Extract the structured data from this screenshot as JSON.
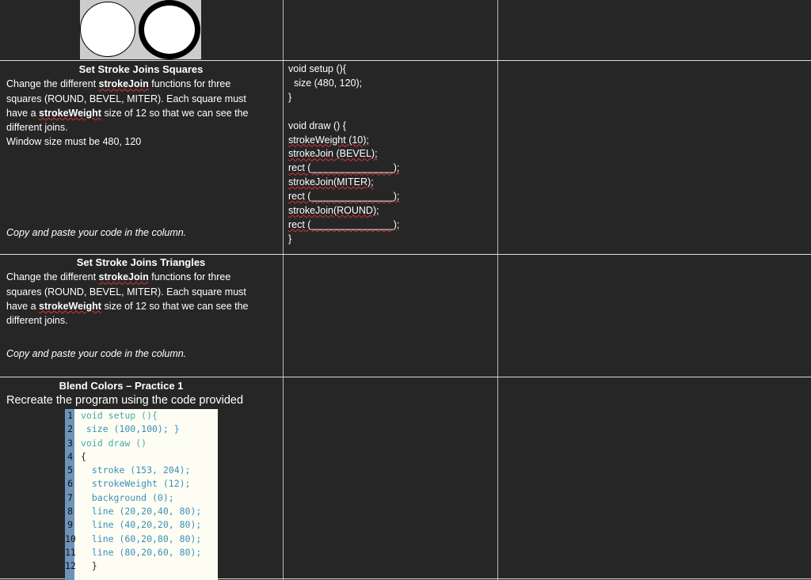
{
  "row1": {
    "title": "Set Stroke Joins Squares",
    "line1_pre": "Change the different ",
    "line1_kw": "strokeJoin",
    "line1_post": " functions for three",
    "line2": "squares (ROUND, BEVEL, MITER). Each square must",
    "line3_pre": "have a ",
    "line3_kw": "strokeWeight",
    "line3_post": " size of 12 so that we can see the",
    "line4": "different joins.",
    "line5": "Window size must be 480, 120",
    "note": "Copy and paste your code in the column.",
    "code": [
      "void setup (){",
      "  size (480, 120);",
      "}",
      "",
      "void draw () {",
      "strokeWeight (10);",
      "strokeJoin (BEVEL);",
      "rect (_______________);",
      "strokeJoin(MITER);",
      "rect (_______________);",
      "strokeJoin(ROUND);",
      "rect (_______________);",
      "}"
    ]
  },
  "row2": {
    "title": "Set Stroke Joins Triangles",
    "line1_pre": "Change the different ",
    "line1_kw": "strokeJoin",
    "line1_post": " functions for three",
    "line2": "squares (ROUND, BEVEL, MITER). Each square must",
    "line3_pre": "have a ",
    "line3_kw": "strokeWeight",
    "line3_post": " size of 12 so that we can see the",
    "line4": "different joins.",
    "note": "Copy and paste your code in the column."
  },
  "row3": {
    "title": "Blend Colors – Practice 1",
    "subtitle": "Recreate the program using the code provided",
    "line_numbers": [
      "1",
      "2",
      "3",
      "4",
      "5",
      "6",
      "7",
      "8",
      "9",
      "10",
      "11",
      "12"
    ],
    "code": [
      "void setup (){",
      " size (100,100); }",
      "void draw ()",
      "{",
      "  stroke (153, 204);",
      "  strokeWeight (12);",
      "  background (0);",
      "  line (20,20,40, 80);",
      "  line (40,20,20, 80);",
      "  line (60,20,80, 80);",
      "  line (80,20,60, 80);",
      "  }"
    ]
  }
}
